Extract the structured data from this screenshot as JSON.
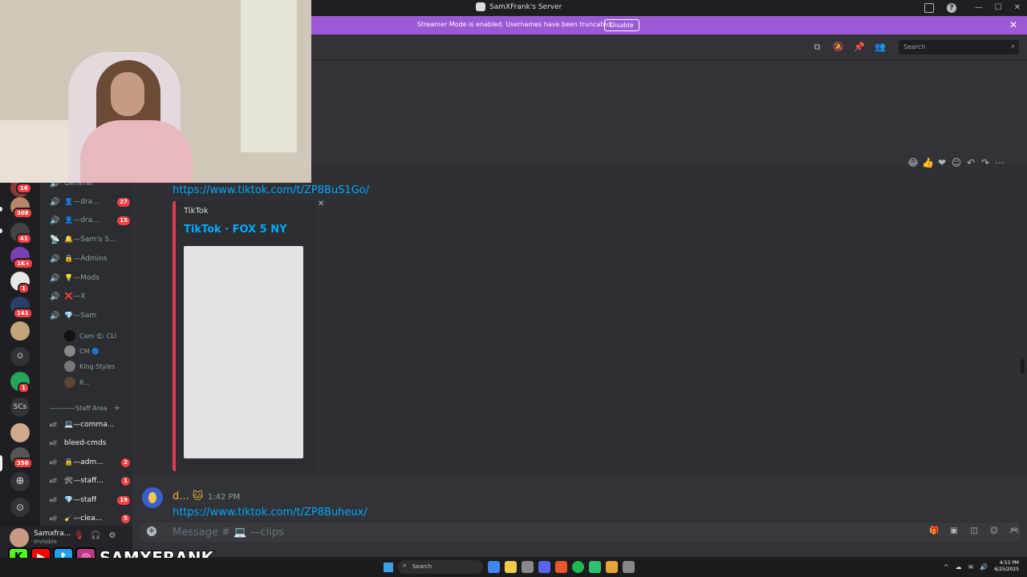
{
  "window": {
    "title": "SamXFrank's Server"
  },
  "banner": {
    "message": "Streamer Mode is enabled. Usernames have been truncated.",
    "disable_label": "Disable"
  },
  "header": {
    "search_placeholder": "Search"
  },
  "chat": {
    "first_link": "https://www.tiktok.com/t/ZP8BuS1Go/",
    "embed": {
      "provider": "TikTok",
      "title": "TikTok · FOX 5 NY"
    },
    "second_message": {
      "username": "d...",
      "time": "1:42 PM",
      "link": "https://www.tiktok.com/t/ZP8Buheux/"
    },
    "composer_placeholder": "Message # 💻 —clips"
  },
  "servers": [
    {
      "badge": "16",
      "color": "#8b3a3a"
    },
    {
      "badge": "308",
      "color": "#b7866a"
    },
    {
      "badge": "41",
      "color": "#444444"
    },
    {
      "badge": "1K+",
      "color": "#7a3fb0"
    },
    {
      "badge": "1",
      "color": "#e8e8e8"
    },
    {
      "badge": "141",
      "color": "#2a3f6b"
    },
    {
      "badge": "",
      "color": "#c4a57a"
    },
    {
      "badge": "1",
      "color": "#23a55a"
    },
    {
      "badge": "",
      "color": "#cfa98c"
    },
    {
      "badge": "356",
      "color": "#555555"
    }
  ],
  "server_text": {
    "o_label": "O",
    "scs_label": "SCs"
  },
  "channels": {
    "voice": [
      {
        "icon": "🔊",
        "name": "General",
        "badge": ""
      },
      {
        "icon": "🔊",
        "name": "👤—dra...",
        "badge": "27"
      },
      {
        "icon": "🔊",
        "name": "👤—dra...",
        "badge": "15"
      },
      {
        "icon": "📡",
        "name": "🔔—Sam's S...",
        "badge": ""
      },
      {
        "icon": "🔊",
        "name": "🔒—Admins",
        "badge": ""
      },
      {
        "icon": "🔊",
        "name": "💡—Mods",
        "badge": ""
      },
      {
        "icon": "🔊",
        "name": "❌—X",
        "badge": ""
      },
      {
        "icon": "🔊",
        "name": "💎—Sam",
        "badge": ""
      }
    ],
    "voice_users": [
      {
        "name": "Cam 🌤 CLI",
        "color": "#111111"
      },
      {
        "name": "CM 🔵",
        "color": "#888888"
      },
      {
        "name": "King Styles",
        "color": "#777777"
      },
      {
        "name": "R...",
        "color": "#5a4632"
      }
    ],
    "category": "————Staff Area",
    "text": [
      {
        "name": "💻—comma...",
        "badge": ""
      },
      {
        "name": "bleed-cmds",
        "badge": ""
      },
      {
        "name": "🔒—adm...",
        "badge": "2"
      },
      {
        "name": "🛠—staff...",
        "badge": "1"
      },
      {
        "name": "💎—staff",
        "badge": "19"
      },
      {
        "name": "🧹—clea...",
        "badge": "5"
      }
    ]
  },
  "user_panel": {
    "name": "Samxfra...",
    "status": "Invisible"
  },
  "overlay": {
    "handle": "SAMXFRANK"
  },
  "taskbar": {
    "search_label": "Search",
    "time": "4:53 PM",
    "date": "6/25/2025"
  }
}
